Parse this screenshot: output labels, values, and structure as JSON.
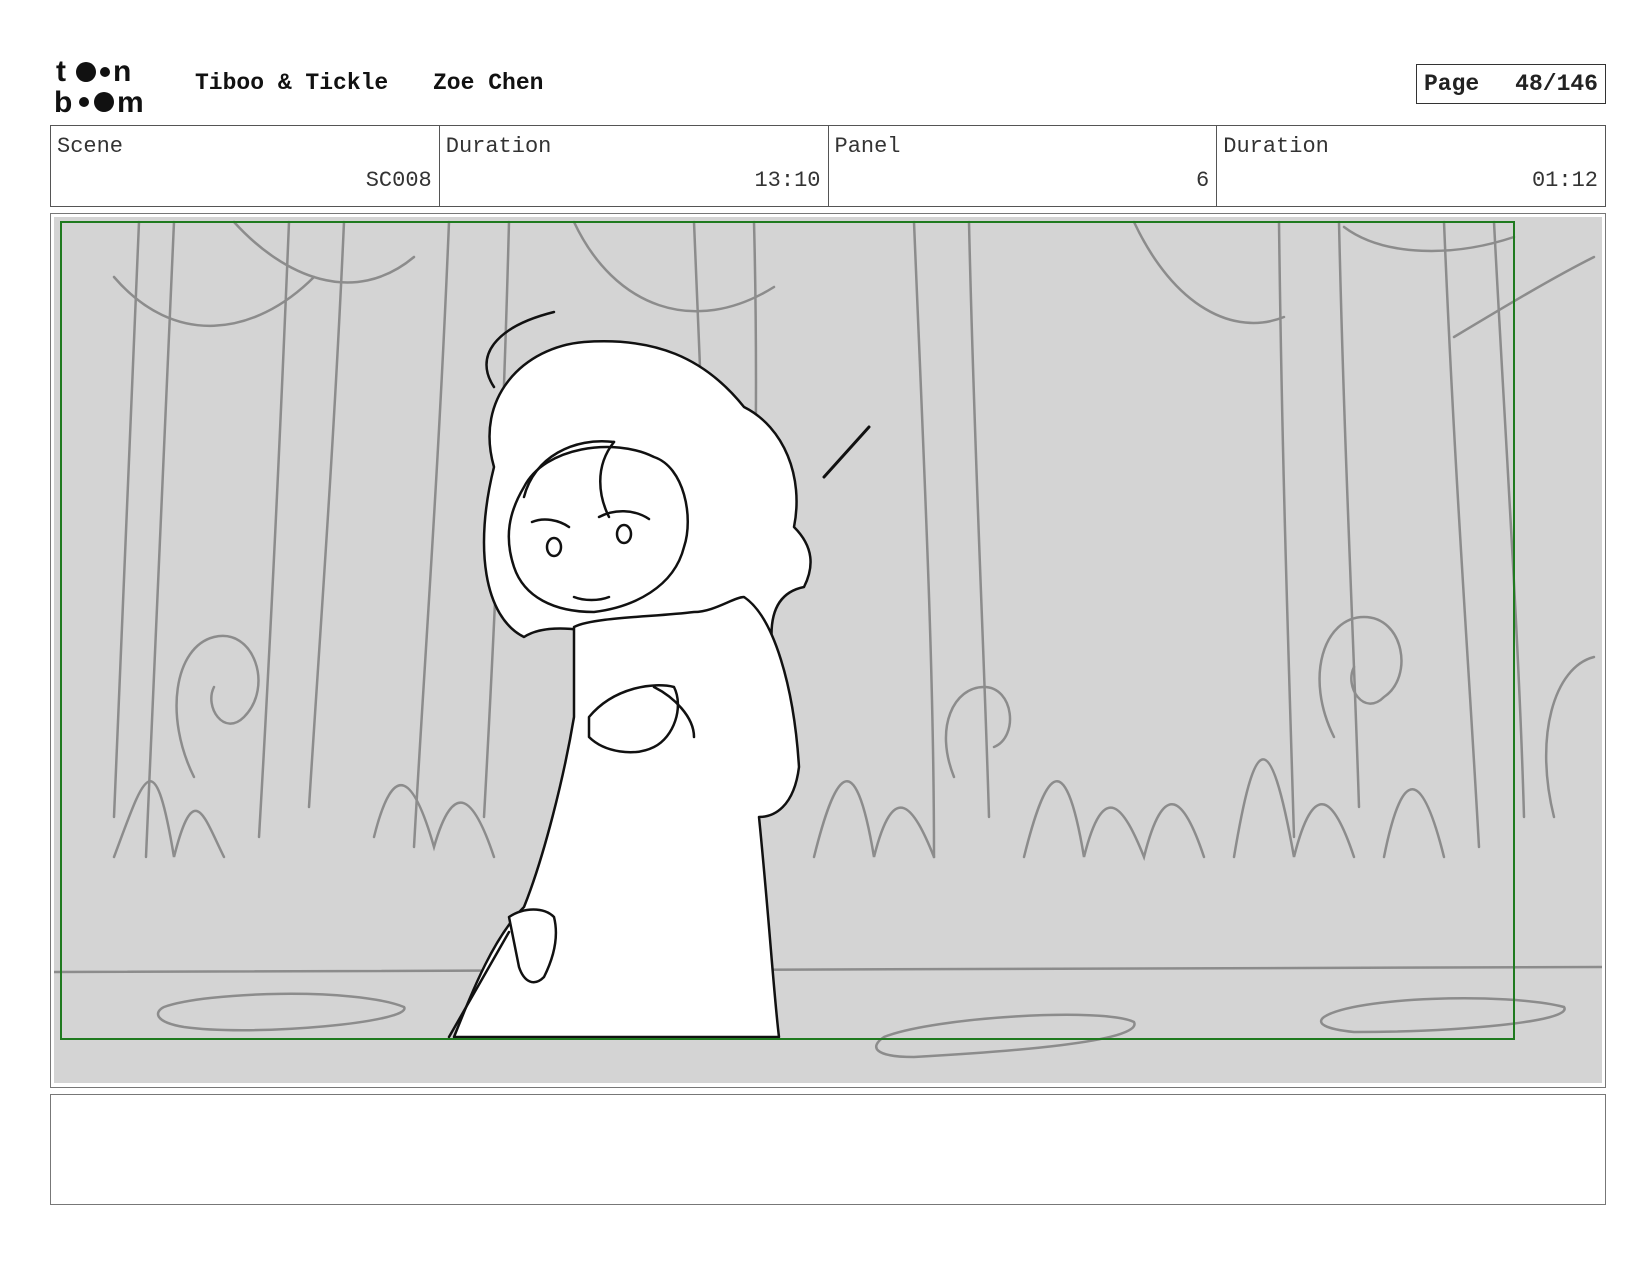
{
  "header": {
    "logo_text": "toon boom",
    "project": "Tiboo & Tickle",
    "author": "Zoe Chen",
    "page_label": "Page",
    "page_number": "48/146"
  },
  "info": {
    "scene_label": "Scene",
    "scene_value": "SC008",
    "scene_duration_label": "Duration",
    "scene_duration_value": "13:10",
    "panel_label": "Panel",
    "panel_value": "6",
    "panel_duration_label": "Duration",
    "panel_duration_value": "01:12"
  },
  "panel": {
    "background_color": "#d4d4d4",
    "safe_frame_color": "#1f7a1f",
    "sketch_line_color": "#8c8c8c"
  },
  "caption": {
    "text": ""
  }
}
